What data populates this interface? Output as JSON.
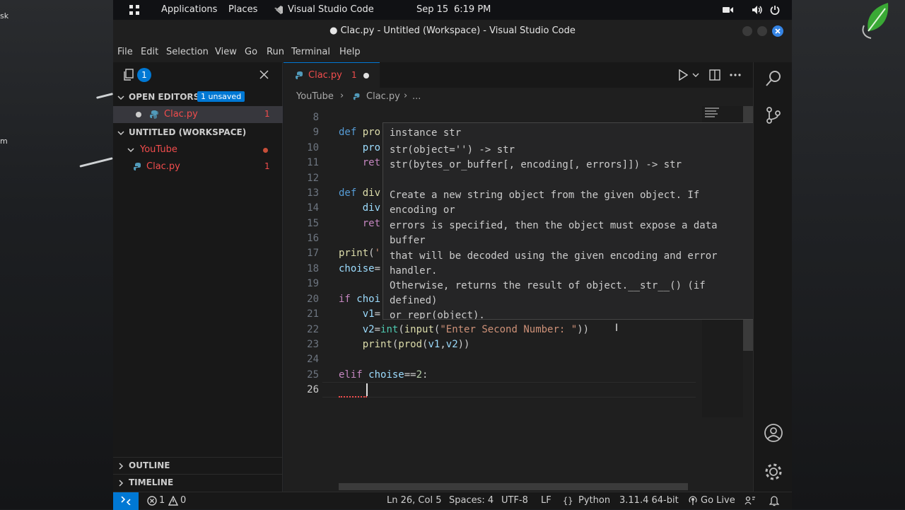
{
  "desktop": {
    "left_label_1": "sk",
    "left_label_2": "m"
  },
  "topbar": {
    "applications": "Applications",
    "places": "Places",
    "app_name": "Visual Studio Code",
    "date": "Sep 15",
    "time": "6:19 PM"
  },
  "window": {
    "title": "● Clac.py - Untitled (Workspace) - Visual Studio Code"
  },
  "menu": [
    "File",
    "Edit",
    "Selection",
    "View",
    "Go",
    "Run",
    "Terminal",
    "Help"
  ],
  "explorer": {
    "badge": "1",
    "open_editors_label": "OPEN EDITORS",
    "unsaved_badge": "1 unsaved",
    "open_file": "Clac.py",
    "open_file_count": "1",
    "workspace_label": "UNTITLED (WORKSPACE)",
    "folder": "YouTube",
    "file": "Clac.py",
    "file_count": "1",
    "outline": "OUTLINE",
    "timeline": "TIMELINE"
  },
  "editor": {
    "tab_name": "Clac.py",
    "tab_problems": "1",
    "breadcrumb_folder": "YouTube",
    "breadcrumb_file": "Clac.py",
    "breadcrumb_more": "...",
    "lines": [
      {
        "n": "8",
        "text": ""
      },
      {
        "n": "9",
        "text": "def pro"
      },
      {
        "n": "10",
        "text": "    pro"
      },
      {
        "n": "11",
        "text": "    ret"
      },
      {
        "n": "12",
        "text": ""
      },
      {
        "n": "13",
        "text": "def div"
      },
      {
        "n": "14",
        "text": "    div"
      },
      {
        "n": "15",
        "text": "    ret"
      },
      {
        "n": "16",
        "text": ""
      },
      {
        "n": "17",
        "text": "print('"
      },
      {
        "n": "18",
        "text": "choise="
      },
      {
        "n": "19",
        "text": ""
      },
      {
        "n": "20",
        "text": "if choi"
      },
      {
        "n": "21",
        "text": "    v1="
      },
      {
        "n": "22",
        "text": "    v2=int(input(\"Enter Second Number: \"))"
      },
      {
        "n": "23",
        "text": "    print(prod(v1,v2))"
      },
      {
        "n": "24",
        "text": ""
      },
      {
        "n": "25",
        "text": "elif choise==2:"
      },
      {
        "n": "26",
        "text": "    "
      }
    ]
  },
  "hover": {
    "lines": [
      "instance str",
      "str(object='') -> str",
      "str(bytes_or_buffer[, encoding[, errors]]) -> str",
      "",
      "Create a new string object from the given object. If",
      "encoding or",
      "errors is specified, then the object must expose a data",
      "buffer",
      "that will be decoded using the given encoding and error",
      "handler.",
      "Otherwise, returns the result of object.__str__() (if",
      "defined)",
      "or repr(object)."
    ]
  },
  "status": {
    "errors": "1",
    "warnings": "0",
    "position": "Ln 26, Col 5",
    "spaces": "Spaces: 4",
    "encoding": "UTF-8",
    "eol": "LF",
    "language": "Python",
    "interpreter": "3.11.4 64-bit",
    "go_live": "Go Live"
  },
  "colors": {
    "accent": "#0078d4",
    "error_file": "#f14c4c",
    "folder_modified": "#c74e39"
  }
}
